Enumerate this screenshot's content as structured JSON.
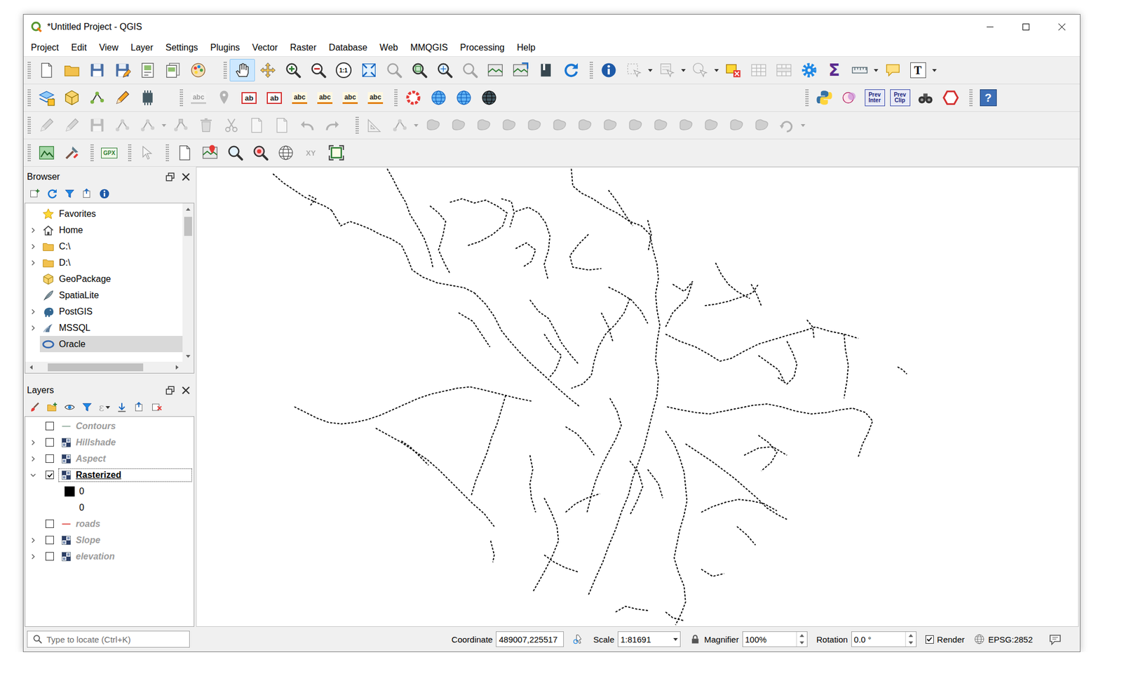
{
  "window": {
    "title": "*Untitled Project - QGIS"
  },
  "menu": [
    "Project",
    "Edit",
    "View",
    "Layer",
    "Settings",
    "Plugins",
    "Vector",
    "Raster",
    "Database",
    "Web",
    "MMQGIS",
    "Processing",
    "Help"
  ],
  "toolbars": [
    {
      "groups": [
        {
          "items": [
            {
              "kind": "button",
              "disabled": false,
              "active": false
            },
            {
              "kind": "button",
              "disabled": false,
              "active": false
            },
            {
              "kind": "button",
              "disabled": false,
              "active": false
            },
            {
              "kind": "button",
              "disabled": false,
              "active": false
            },
            {
              "kind": "button",
              "disabled": false,
              "active": false
            },
            {
              "kind": "button",
              "disabled": false,
              "active": false
            },
            {
              "kind": "button",
              "disabled": false,
              "active": false
            }
          ]
        },
        {
          "items": [
            {
              "kind": "button",
              "disabled": false,
              "active": true
            },
            {
              "kind": "button",
              "disabled": false,
              "active": false
            },
            {
              "kind": "button",
              "disabled": false,
              "active": false
            },
            {
              "kind": "button",
              "disabled": false,
              "active": false
            },
            {
              "kind": "glyph",
              "text": "1:1",
              "disabled": false,
              "active": false
            },
            {
              "kind": "button",
              "disabled": false,
              "active": false
            },
            {
              "kind": "button",
              "disabled": true,
              "active": false
            },
            {
              "kind": "button",
              "disabled": false,
              "active": false
            },
            {
              "kind": "button",
              "disabled": false,
              "active": false
            },
            {
              "kind": "button",
              "disabled": true,
              "active": false
            },
            {
              "kind": "button",
              "disabled": false,
              "active": false
            },
            {
              "kind": "button",
              "disabled": false,
              "active": false
            },
            {
              "kind": "button",
              "disabled": false,
              "active": false
            },
            {
              "kind": "button",
              "disabled": false,
              "active": false
            }
          ]
        },
        {
          "items": [
            {
              "kind": "button",
              "disabled": false,
              "active": false
            },
            {
              "kind": "button",
              "disabled": true,
              "active": false
            },
            {
              "kind": "dropdown",
              "disabled": false
            },
            {
              "kind": "button",
              "disabled": true,
              "active": false
            },
            {
              "kind": "dropdown",
              "disabled": false
            },
            {
              "kind": "button",
              "disabled": true,
              "active": false
            },
            {
              "kind": "dropdown",
              "disabled": false
            },
            {
              "kind": "button",
              "disabled": false,
              "active": false
            },
            {
              "kind": "button",
              "disabled": true,
              "active": false
            },
            {
              "kind": "button",
              "disabled": true,
              "active": false
            },
            {
              "kind": "button",
              "disabled": false,
              "active": false
            },
            {
              "kind": "glyph",
              "text": "Σ",
              "disabled": false,
              "active": false
            },
            {
              "kind": "button",
              "disabled": false,
              "active": false
            },
            {
              "kind": "dropdown",
              "disabled": false
            },
            {
              "kind": "button",
              "disabled": false,
              "active": false
            },
            {
              "kind": "glyph",
              "text": "T",
              "disabled": false,
              "active": false
            },
            {
              "kind": "dropdown",
              "disabled": false
            }
          ]
        }
      ]
    },
    {
      "groups": [
        {
          "items": [
            {
              "kind": "button",
              "disabled": false,
              "active": false
            },
            {
              "kind": "button",
              "disabled": false,
              "active": false
            },
            {
              "kind": "button",
              "disabled": false,
              "active": false
            },
            {
              "kind": "button",
              "disabled": false,
              "active": false
            },
            {
              "kind": "button",
              "disabled": false,
              "active": false
            }
          ]
        },
        {
          "items": [
            {
              "kind": "glyph",
              "text": "abc",
              "disabled": true,
              "active": false
            },
            {
              "kind": "button",
              "disabled": true,
              "active": false
            },
            {
              "kind": "glyph",
              "text": "ab",
              "disabled": false,
              "active": false
            },
            {
              "kind": "glyph",
              "text": "ab",
              "disabled": false,
              "active": false
            },
            {
              "kind": "glyph",
              "text": "abc",
              "disabled": false,
              "active": false
            },
            {
              "kind": "glyph",
              "text": "abc",
              "disabled": false,
              "active": false
            },
            {
              "kind": "glyph",
              "text": "abc",
              "disabled": false,
              "active": false
            },
            {
              "kind": "glyph",
              "text": "abc",
              "disabled": false,
              "active": false
            }
          ]
        },
        {
          "items": [
            {
              "kind": "button",
              "disabled": false,
              "active": false
            },
            {
              "kind": "button",
              "disabled": false,
              "active": false
            },
            {
              "kind": "button",
              "disabled": false,
              "active": false
            },
            {
              "kind": "button",
              "disabled": false,
              "active": false
            }
          ]
        },
        {
          "items": [
            {
              "kind": "button",
              "disabled": false,
              "active": false
            },
            {
              "kind": "button",
              "disabled": false,
              "active": false
            },
            {
              "kind": "glyph",
              "text": "Prev Inter",
              "disabled": false,
              "active": false
            },
            {
              "kind": "glyph",
              "text": "Prev Clip",
              "disabled": false,
              "active": false
            },
            {
              "kind": "button",
              "disabled": false,
              "active": false
            },
            {
              "kind": "button",
              "disabled": false,
              "active": false
            }
          ]
        },
        {
          "items": [
            {
              "kind": "glyph",
              "text": "?",
              "disabled": false,
              "active": false
            }
          ]
        }
      ]
    },
    {
      "groups": [
        {
          "items": [
            {
              "kind": "button",
              "disabled": true,
              "active": false
            },
            {
              "kind": "button",
              "disabled": true,
              "active": false
            },
            {
              "kind": "button",
              "disabled": true,
              "active": false
            },
            {
              "kind": "button",
              "disabled": true,
              "active": false
            },
            {
              "kind": "button",
              "disabled": true,
              "active": false
            },
            {
              "kind": "dropdown",
              "disabled": true
            },
            {
              "kind": "button",
              "disabled": true,
              "active": false
            },
            {
              "kind": "button",
              "disabled": true,
              "active": false
            },
            {
              "kind": "button",
              "disabled": true,
              "active": false
            },
            {
              "kind": "button",
              "disabled": true,
              "active": false
            },
            {
              "kind": "button",
              "disabled": true,
              "active": false
            },
            {
              "kind": "button",
              "disabled": true,
              "active": false
            },
            {
              "kind": "button",
              "disabled": true,
              "active": false
            }
          ]
        },
        {
          "items": [
            {
              "kind": "button",
              "disabled": true,
              "active": false
            },
            {
              "kind": "button",
              "disabled": true,
              "active": false
            },
            {
              "kind": "dropdown",
              "disabled": true
            },
            {
              "kind": "button",
              "disabled": true,
              "active": false
            },
            {
              "kind": "button",
              "disabled": true,
              "active": false
            },
            {
              "kind": "button",
              "disabled": true,
              "active": false
            },
            {
              "kind": "button",
              "disabled": true,
              "active": false
            },
            {
              "kind": "button",
              "disabled": true,
              "active": false
            },
            {
              "kind": "button",
              "disabled": true,
              "active": false
            },
            {
              "kind": "button",
              "disabled": true,
              "active": false
            },
            {
              "kind": "button",
              "disabled": true,
              "active": false
            },
            {
              "kind": "button",
              "disabled": true,
              "active": false
            },
            {
              "kind": "button",
              "disabled": true,
              "active": false
            },
            {
              "kind": "button",
              "disabled": true,
              "active": false
            },
            {
              "kind": "button",
              "disabled": true,
              "active": false
            },
            {
              "kind": "button",
              "disabled": true,
              "active": false
            },
            {
              "kind": "button",
              "disabled": true,
              "active": false
            },
            {
              "kind": "button",
              "disabled": true,
              "active": false
            },
            {
              "kind": "dropdown",
              "disabled": true
            }
          ]
        }
      ]
    },
    {
      "groups": [
        {
          "items": [
            {
              "kind": "button",
              "disabled": false,
              "active": false
            },
            {
              "kind": "button",
              "disabled": false,
              "active": false
            }
          ]
        },
        {
          "items": [
            {
              "kind": "glyph",
              "text": "GPX",
              "disabled": false,
              "active": false
            }
          ]
        },
        {
          "items": [
            {
              "kind": "button",
              "disabled": true,
              "active": false
            }
          ]
        },
        {
          "items": [
            {
              "kind": "button",
              "disabled": false,
              "active": false
            },
            {
              "kind": "button",
              "disabled": false,
              "active": false
            },
            {
              "kind": "button",
              "disabled": false,
              "active": false
            },
            {
              "kind": "button",
              "disabled": false,
              "active": false
            },
            {
              "kind": "button",
              "disabled": false,
              "active": false
            },
            {
              "kind": "glyph",
              "text": "XY",
              "disabled": true,
              "active": false
            },
            {
              "kind": "button",
              "disabled": false,
              "active": false
            }
          ]
        }
      ]
    }
  ],
  "browser": {
    "title": "Browser",
    "items": [
      {
        "label": "Favorites",
        "expandable": false,
        "selected": false
      },
      {
        "label": "Home",
        "expandable": true,
        "selected": false
      },
      {
        "label": "C:\\",
        "expandable": true,
        "selected": false
      },
      {
        "label": "D:\\",
        "expandable": true,
        "selected": false
      },
      {
        "label": "GeoPackage",
        "expandable": false,
        "selected": false
      },
      {
        "label": "SpatiaLite",
        "expandable": false,
        "selected": false
      },
      {
        "label": "PostGIS",
        "expandable": true,
        "selected": false
      },
      {
        "label": "MSSQL",
        "expandable": true,
        "selected": false
      },
      {
        "label": "Oracle",
        "expandable": false,
        "selected": true
      }
    ]
  },
  "layers": {
    "title": "Layers",
    "toolbar": [
      {
        "kind": "button",
        "disabled": false
      },
      {
        "kind": "button",
        "disabled": false
      },
      {
        "kind": "button",
        "disabled": false
      },
      {
        "kind": "button",
        "disabled": false
      },
      {
        "kind": "glyph",
        "text": "ε",
        "disabled": true
      },
      {
        "kind": "dropdown",
        "disabled": false
      },
      {
        "kind": "button",
        "disabled": false
      },
      {
        "kind": "button",
        "disabled": false
      },
      {
        "kind": "button",
        "disabled": false
      }
    ],
    "items": [
      {
        "name": "Contours",
        "kind": "line",
        "color": "#9db5a8",
        "visible": false,
        "expandable": false,
        "expanded": false,
        "selected": false,
        "legend": []
      },
      {
        "name": "Hillshade",
        "kind": "raster",
        "visible": false,
        "expandable": true,
        "expanded": false,
        "selected": false,
        "legend": []
      },
      {
        "name": "Aspect",
        "kind": "raster",
        "visible": false,
        "expandable": true,
        "expanded": false,
        "selected": false,
        "legend": []
      },
      {
        "name": "Rasterized",
        "kind": "raster",
        "visible": true,
        "expandable": true,
        "expanded": true,
        "selected": true,
        "legend": [
          {
            "label": "0",
            "color": "#000000"
          },
          {
            "label": "0",
            "color": "#ffffff"
          }
        ]
      },
      {
        "name": "roads",
        "kind": "line",
        "color": "#e0564f",
        "visible": false,
        "expandable": false,
        "expanded": false,
        "selected": false,
        "legend": []
      },
      {
        "name": "Slope",
        "kind": "raster",
        "visible": false,
        "expandable": true,
        "expanded": false,
        "selected": false,
        "legend": []
      },
      {
        "name": "elevation",
        "kind": "raster",
        "visible": false,
        "expandable": true,
        "expanded": false,
        "selected": false,
        "legend": []
      }
    ]
  },
  "status_bar": {
    "search_placeholder": "Type to locate (Ctrl+K)",
    "coordinate_label": "Coordinate",
    "coordinate": "489007,225517",
    "scale_label": "Scale",
    "scale": "1:81691",
    "magnifier_label": "Magnifier",
    "magnifier": "100%",
    "rotation_label": "Rotation",
    "rotation": "0.0 °",
    "render_label": "Render",
    "render": true,
    "crs": "EPSG:2852"
  }
}
